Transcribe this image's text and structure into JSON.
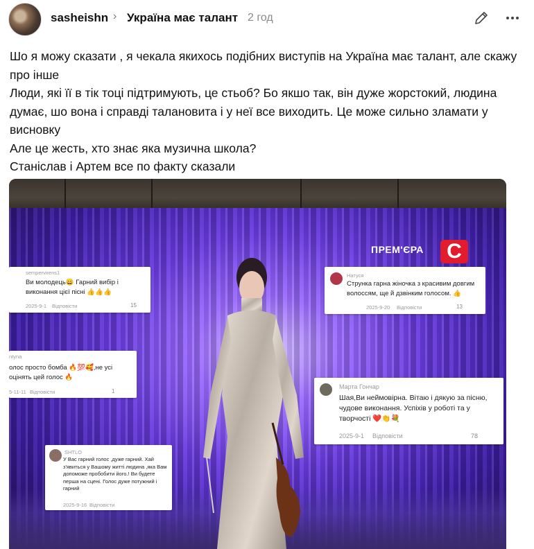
{
  "post": {
    "username": "sasheishn",
    "community": "Україна має талант",
    "time": "2 год",
    "edit_icon": "pencil-icon",
    "more_icon": "more-dots-icon",
    "lines": [
      "Шо я можу сказати , я чекала якихось подібних виступів на Україна має талант, але скажу про інше",
      "Люди, які її в тік тоці підтримують, це стьоб? Бо якшо так, він дуже жорстокий, людина думає, шо вона і справді талановита і у неї все виходить. Це може сильно зламати у висновку",
      "Але це жесть, хто знає яка музична школа?",
      "Станіслав і Артем все по факту сказали"
    ]
  },
  "image": {
    "premiere": "ПРЕМ'ЄРА",
    "logo_letter": "С",
    "logo_color": "#e21b2e",
    "comments": [
      {
        "user": "sempervirens1",
        "text": "Ви молодець😄 Гарний вибір і виконання цієї пісні 👍👍👍",
        "date": "2025-9-1",
        "reply": "Відповісти",
        "likes": "15"
      },
      {
        "user": "Натуся",
        "text": "Струнка гарна жіночка з красивим довгим волоссям, ще й дзвінким голосом. 👍",
        "date": "2025-9-20",
        "reply": "Відповісти",
        "likes": "13"
      },
      {
        "user": "ntyna",
        "text": "олос просто бомба 🔥💯🥰,не усі оцінять цей голос 🔥",
        "date": "5-11-11",
        "reply": "Відповісти",
        "likes": "1"
      },
      {
        "user": "Марта Гончар",
        "text": "Шая,Ви неймовірна. Вітаю і дякую за пісню, чудове виконання. Успіхів у роботі та у творчості ❤️👏💐",
        "date": "2025-9-1",
        "reply": "Відповісти",
        "likes": "78"
      },
      {
        "user": "SHTLO",
        "text": "У Вас гарний голос ,дуже гарний. Хай з'явиться у Вашому житті людина ,яка Вам допоможе пробобити його.! Ви будете перша на сцені. Голос дуже потужний і гарний",
        "date": "2025-9-16",
        "reply": "Відповісти",
        "likes": ""
      }
    ]
  }
}
